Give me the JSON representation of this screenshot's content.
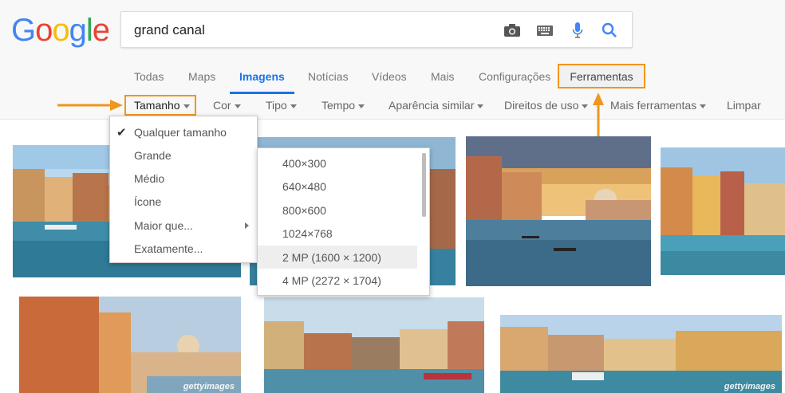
{
  "logo": {
    "letters": [
      "G",
      "o",
      "o",
      "g",
      "l",
      "e"
    ]
  },
  "search": {
    "value": "grand canal"
  },
  "search_icons": [
    "camera-icon",
    "keyboard-icon",
    "mic-icon",
    "search-icon"
  ],
  "tabs": [
    {
      "label": "Todas"
    },
    {
      "label": "Maps"
    },
    {
      "label": "Imagens"
    },
    {
      "label": "Notícias"
    },
    {
      "label": "Vídeos"
    },
    {
      "label": "Mais"
    },
    {
      "label": "Configurações"
    },
    {
      "label": "Ferramentas"
    }
  ],
  "tools": [
    {
      "label": "Tamanho"
    },
    {
      "label": "Cor"
    },
    {
      "label": "Tipo"
    },
    {
      "label": "Tempo"
    },
    {
      "label": "Aparência similar"
    },
    {
      "label": "Direitos de uso"
    },
    {
      "label": "Mais ferramentas"
    },
    {
      "label": "Limpar"
    }
  ],
  "size_menu": {
    "items": [
      {
        "label": "Qualquer tamanho",
        "checked": true
      },
      {
        "label": "Grande"
      },
      {
        "label": "Médio"
      },
      {
        "label": "Ícone"
      },
      {
        "label": "Maior que..."
      },
      {
        "label": "Exatamente..."
      }
    ]
  },
  "larger_than_menu": {
    "items": [
      {
        "label": "400×300"
      },
      {
        "label": "640×480"
      },
      {
        "label": "800×600"
      },
      {
        "label": "1024×768"
      },
      {
        "label": "2 MP (1600 × 1200)"
      },
      {
        "label": "4 MP (2272 × 1704)"
      }
    ]
  },
  "images": {
    "watermark": "gettyimages"
  },
  "colors": {
    "accent_blue": "#1a73e8",
    "highlight_orange": "#f0961c"
  }
}
